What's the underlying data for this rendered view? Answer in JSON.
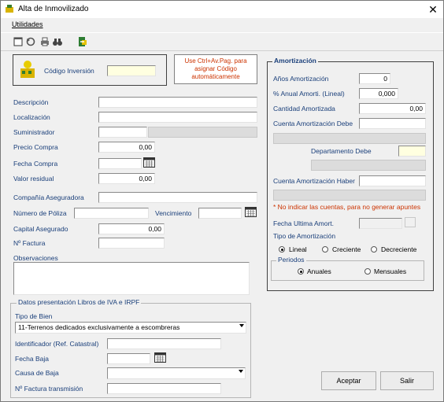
{
  "window": {
    "title": "Alta de Inmovilizado",
    "close_glyph": "✕"
  },
  "menu": {
    "utilidades": "Utilidades"
  },
  "toolbar": {
    "icons": [
      "new-icon",
      "undo-icon",
      "print-icon",
      "binoculars-icon",
      "exit-icon"
    ]
  },
  "codigo": {
    "label": "Código Inversión",
    "value": "",
    "hint": "Use Ctrl+Av.Pag. para asignar Código automáticamente"
  },
  "main": {
    "descripcion": {
      "label": "Descripción",
      "value": ""
    },
    "localizacion": {
      "label": "Localización",
      "value": ""
    },
    "suministrador": {
      "label": "Suministrador",
      "value": ""
    },
    "precio_compra": {
      "label": "Precio Compra",
      "value": "0,00"
    },
    "fecha_compra": {
      "label": "Fecha Compra",
      "value": ""
    },
    "valor_residual": {
      "label": "Valor residual",
      "value": "0,00"
    },
    "compania": {
      "label": "Compañía Aseguradora",
      "value": ""
    },
    "poliza": {
      "label": "Número de Póliza",
      "value": ""
    },
    "vencimiento": {
      "label": "Vencimiento",
      "value": ""
    },
    "capital": {
      "label": "Capital Asegurado",
      "value": "0,00"
    },
    "factura": {
      "label": "Nº Factura",
      "value": ""
    },
    "observaciones": {
      "label": "Observaciones",
      "value": ""
    }
  },
  "iva": {
    "group_title": "Datos presentación Libros de IVA e IRPF",
    "tipo_bien": {
      "label": "Tipo de Bien",
      "value": "11-Terrenos dedicados exclusivamente a escombreras"
    },
    "identificador": {
      "label": "Identificador (Ref. Catastral)",
      "value": ""
    },
    "fecha_baja": {
      "label": "Fecha Baja",
      "value": ""
    },
    "causa_baja": {
      "label": "Causa de Baja",
      "value": ""
    },
    "factura_transmision": {
      "label": "Nº Factura transmisión",
      "value": ""
    }
  },
  "amortizacion": {
    "group_title": "Amortización",
    "anos": {
      "label": "Años Amortización",
      "value": "0"
    },
    "pct_anual": {
      "label": "% Anual Amorti. (Lineal)",
      "value": "0,000"
    },
    "cantidad": {
      "label": "Cantidad Amortizada",
      "value": "0,00"
    },
    "cuenta_debe": {
      "label": "Cuenta Amortización Debe",
      "value": ""
    },
    "departamento_debe": {
      "label": "Departamento Debe",
      "value": ""
    },
    "cuenta_haber": {
      "label": "Cuenta Amortización Haber",
      "value": ""
    },
    "warning": "* No indicar las cuentas, para no generar apuntes",
    "fecha_ultima": {
      "label": "Fecha Ultima Amort.",
      "value": ""
    },
    "tipo": {
      "label": "Tipo de Amortización",
      "options": [
        "Lineal",
        "Creciente",
        "Decreciente"
      ],
      "selected": "Lineal"
    },
    "periodos": {
      "label": "Periodos",
      "options": [
        "Anuales",
        "Mensuales"
      ],
      "selected": "Anuales"
    }
  },
  "buttons": {
    "aceptar": "Aceptar",
    "salir": "Salir"
  },
  "colors": {
    "label": "#1a3f7a",
    "warning": "#cc3300",
    "hint": "#cc3300",
    "yellow_field": "#ffffe0"
  }
}
